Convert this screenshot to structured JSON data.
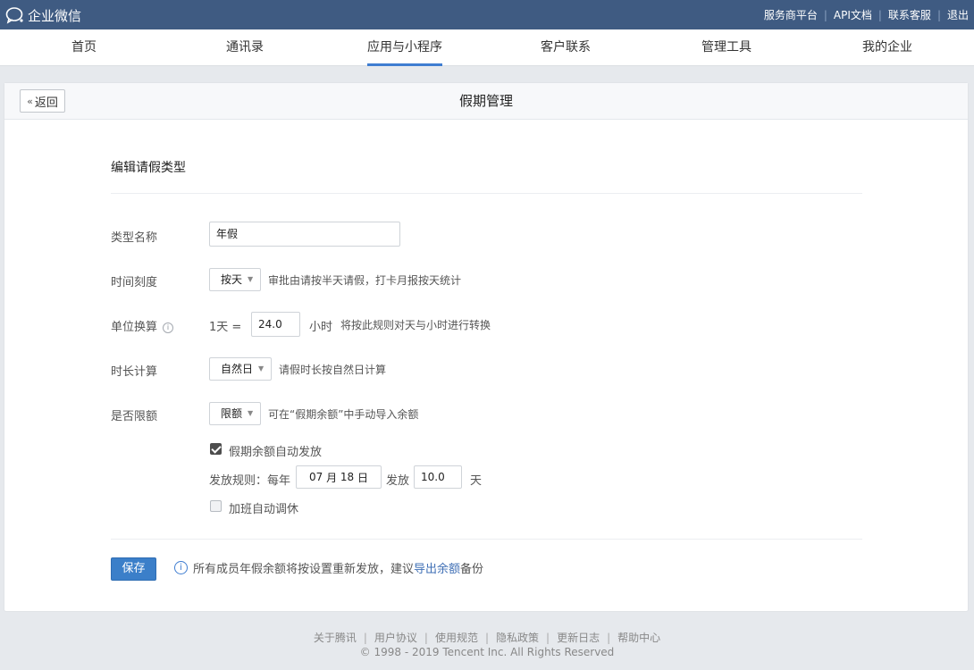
{
  "topbar": {
    "logo_text": "企业微信",
    "links": [
      "服务商平台",
      "API文档",
      "联系客服",
      "退出"
    ]
  },
  "nav": {
    "items": [
      "首页",
      "通讯录",
      "应用与小程序",
      "客户联系",
      "管理工具",
      "我的企业"
    ],
    "active_index": 2
  },
  "page": {
    "back_label": "返回",
    "title": "假期管理",
    "section_title": "编辑请假类型"
  },
  "form": {
    "type_name": {
      "label": "类型名称",
      "value": "年假"
    },
    "time_scale": {
      "label": "时间刻度",
      "value": "按天",
      "hint": "审批由请按半天请假，打卡月报按天统计"
    },
    "unit_conversion": {
      "label": "单位换算",
      "prefix": "1天 =",
      "value": "24.0",
      "unit": "小时",
      "hint": "将按此规则对天与小时进行转换"
    },
    "duration_calc": {
      "label": "时长计算",
      "value": "自然日",
      "hint": "请假时长按自然日计算"
    },
    "quota_limit": {
      "label": "是否限额",
      "value": "限额",
      "hint": "可在“假期余额”中手动导入余额"
    },
    "auto_issue": {
      "label": "假期余额自动发放",
      "checked": true
    },
    "issue_rule": {
      "prefix": "发放规则：每年",
      "month": "07",
      "month_unit": "月",
      "day": "18",
      "day_unit": "日",
      "issue_label": "发放",
      "amount": "10.0",
      "unit": "天"
    },
    "overtime_leave": {
      "label": "加班自动调休",
      "checked": false
    }
  },
  "actions": {
    "save_label": "保存",
    "notice_text": "所有成员年假余额将按设置重新发放，建议",
    "notice_link": "导出余额",
    "notice_suffix": "备份"
  },
  "footer": {
    "links": [
      "关于腾讯",
      "用户协议",
      "使用规范",
      "隐私政策",
      "更新日志",
      "帮助中心"
    ],
    "copyright": "© 1998 - 2019 Tencent Inc. All Rights Reserved"
  },
  "colors": {
    "topbar": "#3f5b82",
    "accent": "#3f7dd1",
    "primary_button": "#3b7fc9"
  }
}
